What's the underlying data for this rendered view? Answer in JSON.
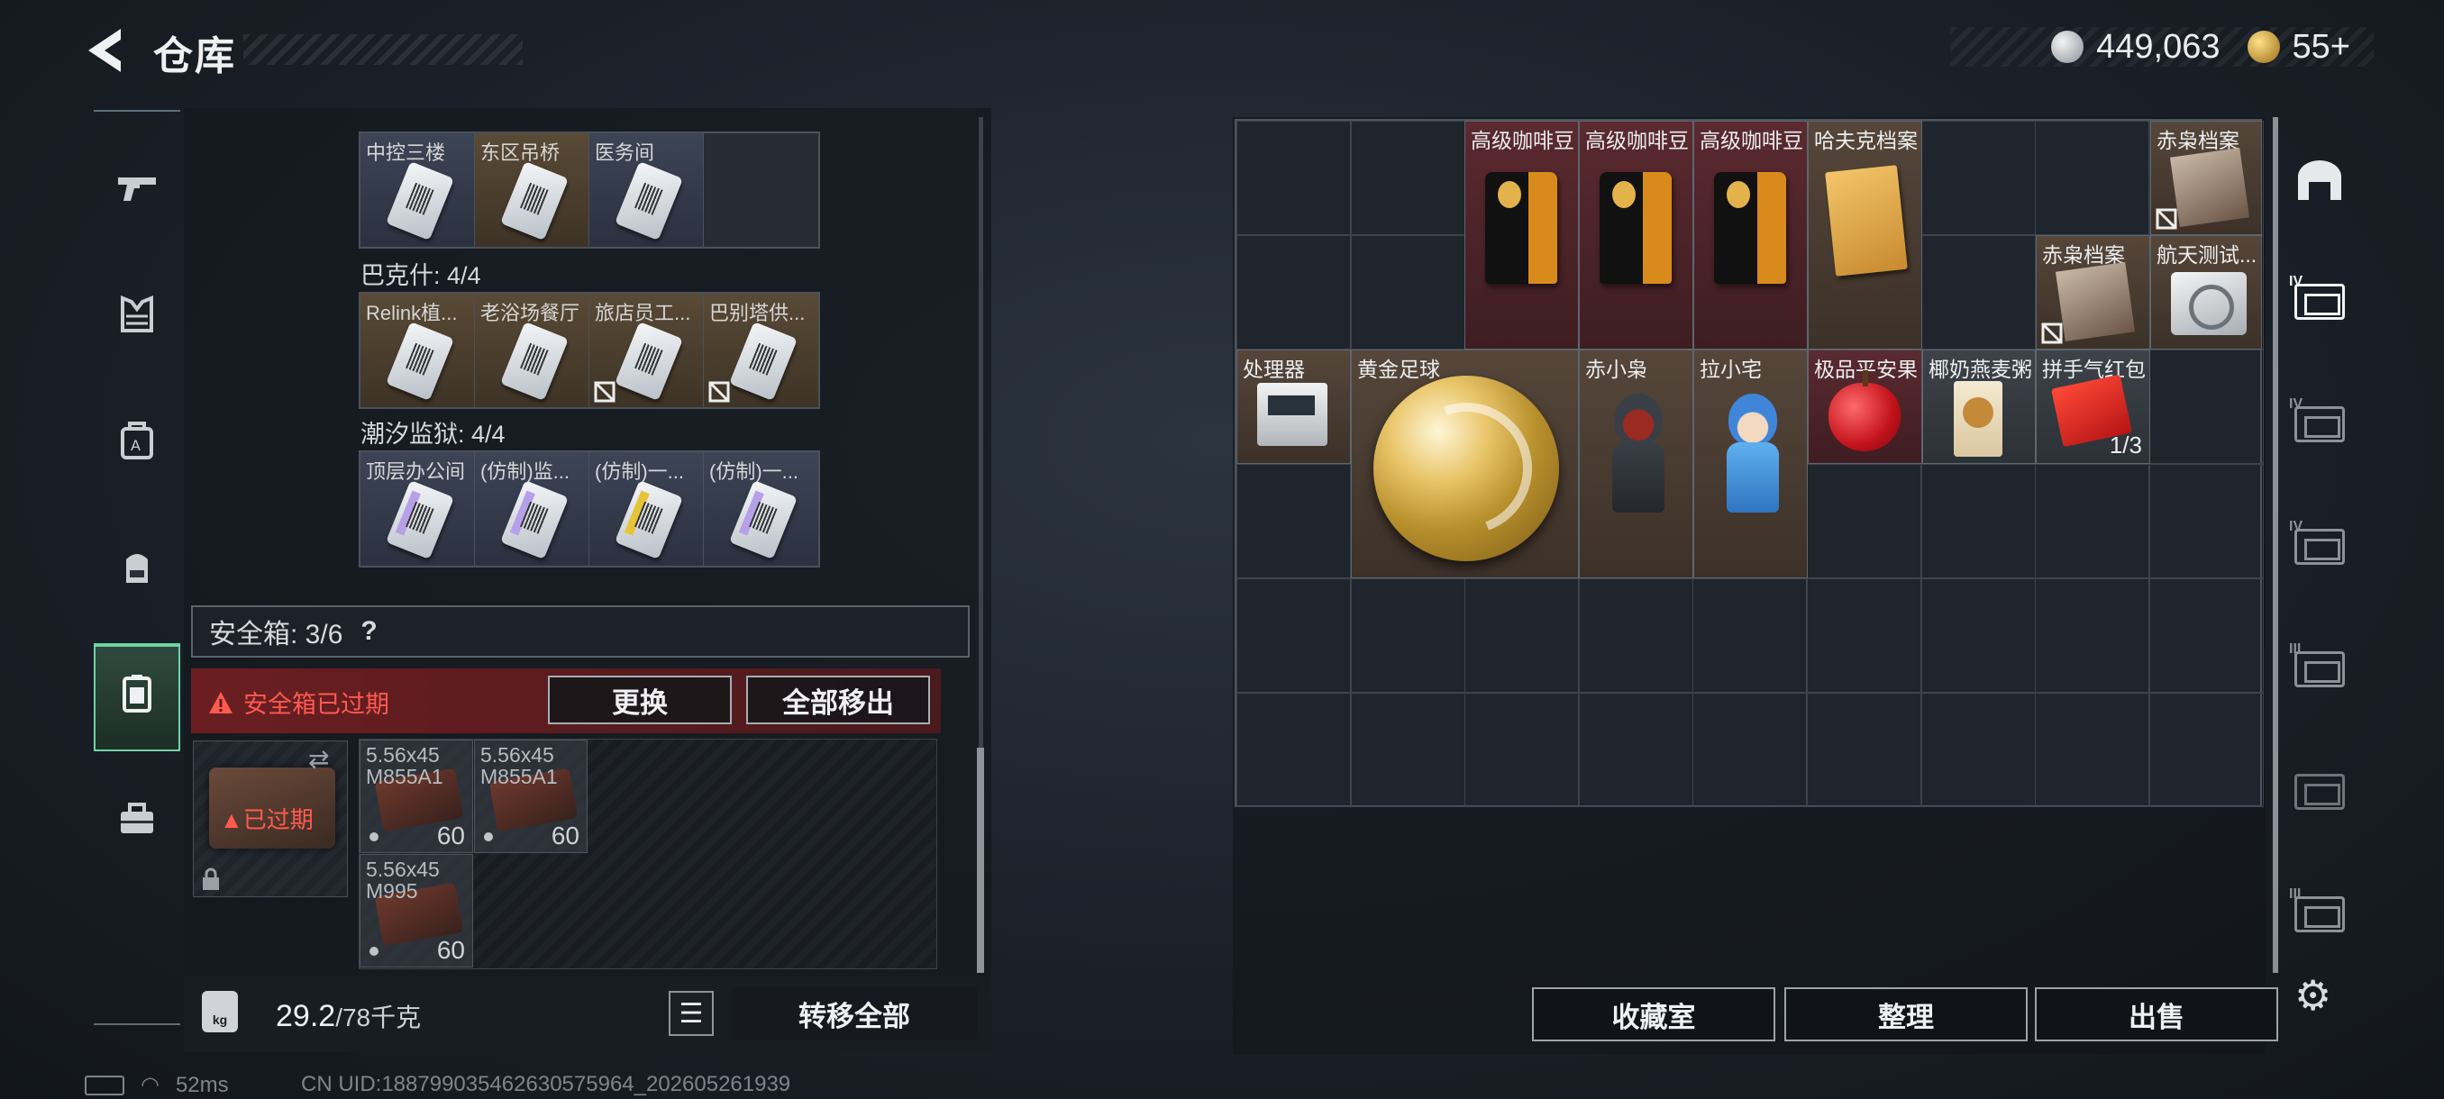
{
  "header": {
    "title": "仓库",
    "currency_silver": "449,063",
    "currency_gold": "55+"
  },
  "nav": {
    "items": [
      "gun-icon",
      "armor-icon",
      "vest-icon",
      "backpack-icon",
      "safe-box-icon",
      "toolbox-icon"
    ],
    "active": "safe-box-icon"
  },
  "keys": {
    "rows": [
      {
        "items": [
          "中控三楼",
          "东区吊桥",
          "医务间",
          ""
        ]
      },
      {
        "label": "巴克什: 4/4",
        "items": [
          "Relink植...",
          "老浴场餐厅",
          "旅店员工...",
          "巴别塔供..."
        ]
      },
      {
        "label": "潮汐监狱: 4/4",
        "items": [
          "顶层办公间",
          "(仿制)监...",
          "(仿制)一...",
          "(仿制)一..."
        ]
      }
    ]
  },
  "safe": {
    "label": "安全箱: 3/6",
    "help": "?",
    "expired_warning": "安全箱已过期",
    "replace_btn": "更换",
    "remove_all_btn": "全部移出",
    "expired_tag": "已过期",
    "ammo": [
      {
        "name": "5.56x45\nM855A1",
        "count": "60"
      },
      {
        "name": "5.56x45\nM855A1",
        "count": "60"
      },
      {
        "name": "5.56x45\nM995",
        "count": "60"
      }
    ]
  },
  "weight": {
    "current": "29.2",
    "max": "/78千克",
    "icon": "kg"
  },
  "transfer_all": "转移全部",
  "status": {
    "ping": "52ms",
    "uid": "CN UID:18879903546263057596​4_202605261939"
  },
  "grid_items": [
    {
      "name": "高级咖啡豆"
    },
    {
      "name": "高级咖啡豆"
    },
    {
      "name": "高级咖啡豆"
    },
    {
      "name": "哈夫克档案"
    },
    {
      "name": "赤枭档案"
    },
    {
      "name": "赤枭档案"
    },
    {
      "name": "航天测试..."
    },
    {
      "name": "处理器"
    },
    {
      "name": "黄金足球"
    },
    {
      "name": "赤小枭"
    },
    {
      "name": "拉小宅"
    },
    {
      "name": "极品平安果"
    },
    {
      "name": "椰奶燕麦粥"
    },
    {
      "name": "拼手气红包",
      "count": "1/3"
    }
  ],
  "bottom_buttons": {
    "collection": "收藏室",
    "arrange": "整理",
    "sell": "出售"
  },
  "right_nav": {
    "levels": [
      "",
      "IV",
      "IV",
      "IV",
      "III",
      "",
      "III"
    ]
  }
}
